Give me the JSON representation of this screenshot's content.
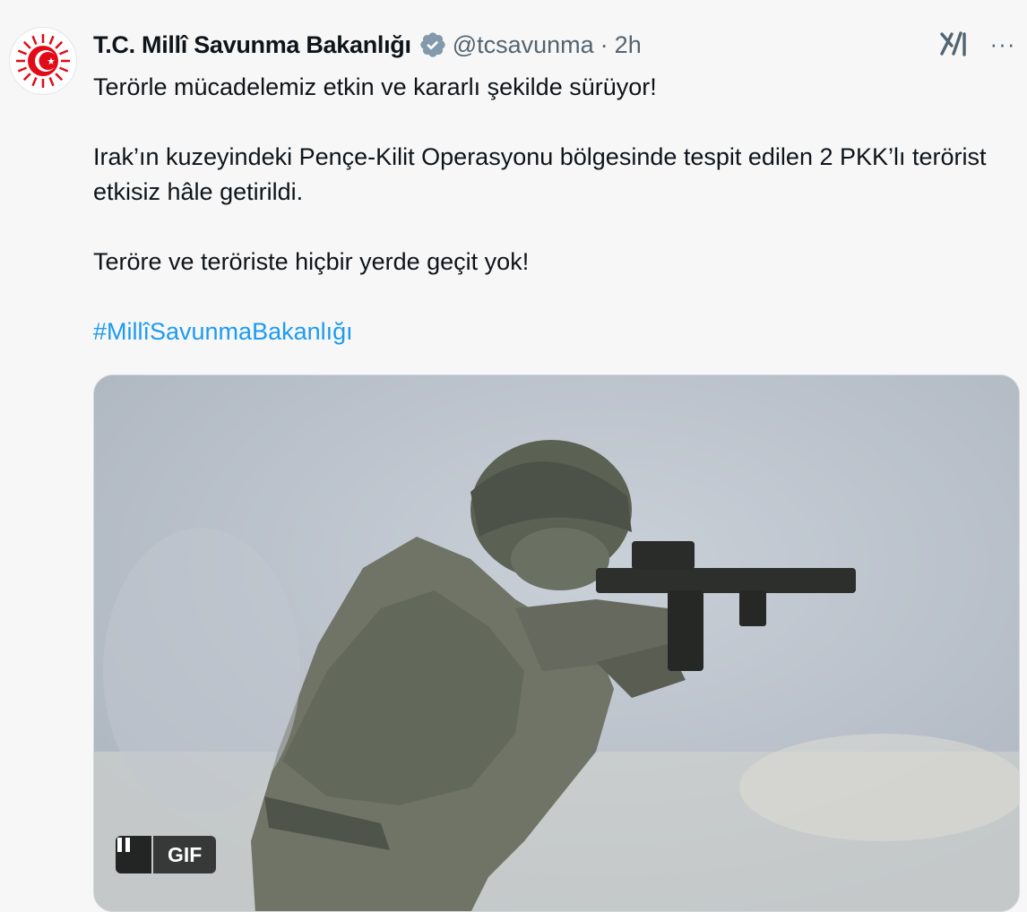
{
  "author": {
    "display_name": "T.C. Millî Savunma Bakanlığı",
    "handle": "@tcsavunma",
    "separator": "·",
    "timestamp": "2h",
    "verified_badge": "verified-badge-icon",
    "verified_color": "#829aab"
  },
  "actions": {
    "grok_icon": "grok-icon",
    "more_icon": "more-options-icon",
    "more_label": "···"
  },
  "tweet": {
    "paragraphs": [
      "Terörle mücadelemiz etkin ve kararlı şekilde sürüyor!",
      "Irak’ın kuzeyindeki Pençe-Kilit Operasyonu bölgesinde tespit edilen 2 PKK’lı terörist etkisiz hâle getirildi.",
      "Teröre ve teröriste hiçbir yerde geçit yok!"
    ],
    "hashtag": "#MillîSavunmaBakanlığı",
    "hashtag_color": "#1d9bf0"
  },
  "media": {
    "type": "gif",
    "badge": "GIF",
    "pause_icon": "pause-icon"
  }
}
